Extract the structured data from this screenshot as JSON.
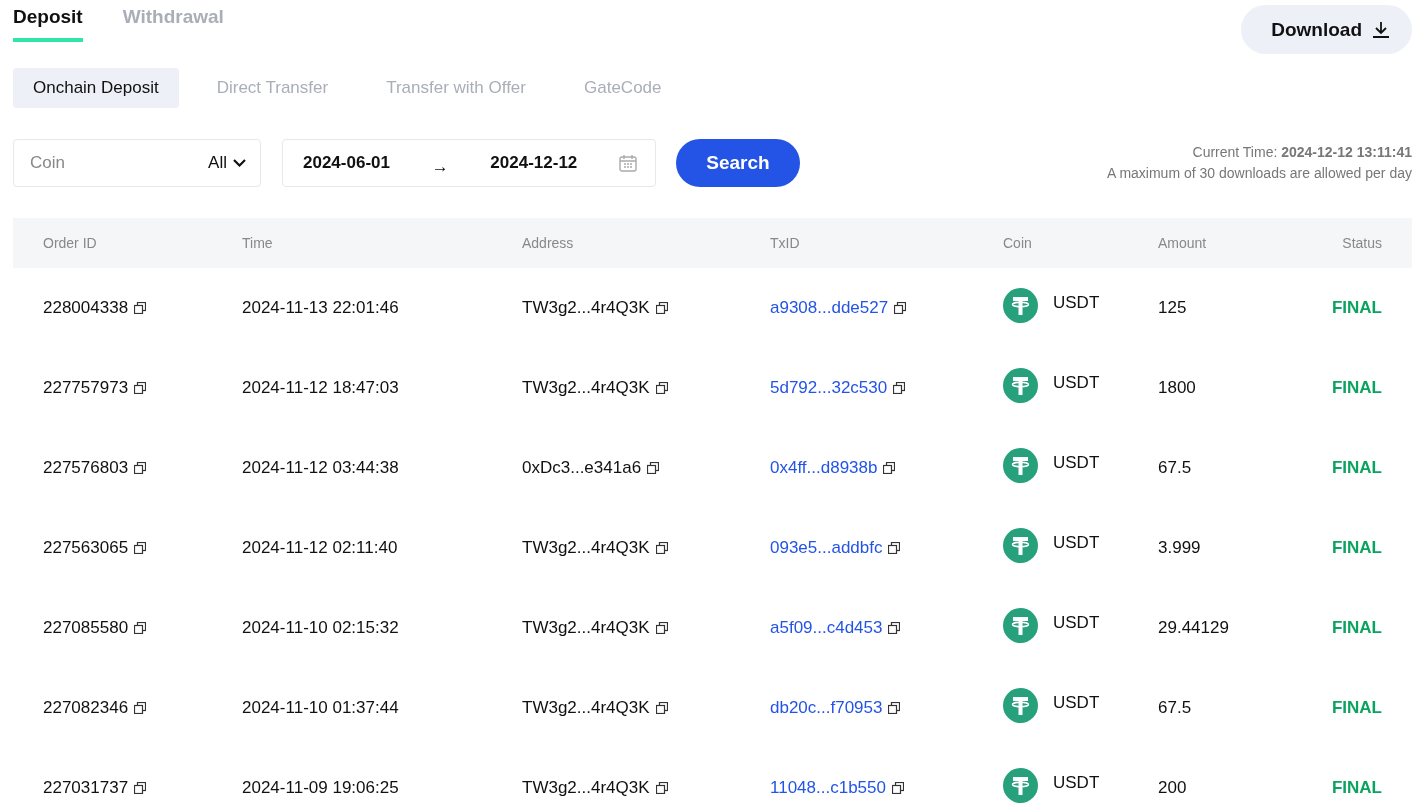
{
  "tabs": [
    {
      "label": "Deposit",
      "selected": true
    },
    {
      "label": "Withdrawal",
      "selected": false
    }
  ],
  "download_button": {
    "label": "Download"
  },
  "sub_tabs": [
    {
      "label": "Onchain Deposit",
      "selected": true
    },
    {
      "label": "Direct Transfer",
      "selected": false
    },
    {
      "label": "Transfer with Offer",
      "selected": false
    },
    {
      "label": "GateCode",
      "selected": false
    }
  ],
  "filters": {
    "coin": {
      "placeholder": "Coin",
      "value": "All"
    },
    "date_range": {
      "start": "2024-06-01",
      "separator": "→",
      "end": "2024-12-12"
    },
    "search_button": "Search"
  },
  "info": {
    "current_time": "Current Time: **2024-12-12 13:11:41**",
    "limit": "A maximum of 30 downloads are allowed per day"
  },
  "table": {
    "columns": [
      "Order ID",
      "Time",
      "Address",
      "TxID",
      "Coin",
      "Amount",
      "Status"
    ],
    "rows": [
      {
        "order_id": "228004338",
        "time": "2024-11-13 22:01:46",
        "address": "TW3g2...4r4Q3K",
        "txid": "a9308...dde527",
        "coin": "USDT",
        "amount": "125",
        "status": "FINAL"
      },
      {
        "order_id": "227757973",
        "time": "2024-11-12 18:47:03",
        "address": "TW3g2...4r4Q3K",
        "txid": "5d792...32c530",
        "coin": "USDT",
        "amount": "1800",
        "status": "FINAL"
      },
      {
        "order_id": "227576803",
        "time": "2024-11-12 03:44:38",
        "address": "0xDc3...e341a6",
        "txid": "0x4ff...d8938b",
        "coin": "USDT",
        "amount": "67.5",
        "status": "FINAL"
      },
      {
        "order_id": "227563065",
        "time": "2024-11-12 02:11:40",
        "address": "TW3g2...4r4Q3K",
        "txid": "093e5...addbfc",
        "coin": "USDT",
        "amount": "3.999",
        "status": "FINAL"
      },
      {
        "order_id": "227085580",
        "time": "2024-11-10 02:15:32",
        "address": "TW3g2...4r4Q3K",
        "txid": "a5f09...c4d453",
        "coin": "USDT",
        "amount": "29.44129",
        "status": "FINAL"
      },
      {
        "order_id": "227082346",
        "time": "2024-11-10 01:37:44",
        "address": "TW3g2...4r4Q3K",
        "txid": "db20c...f70953",
        "coin": "USDT",
        "amount": "67.5",
        "status": "FINAL"
      },
      {
        "order_id": "227031737",
        "time": "2024-11-09 19:06:25",
        "address": "TW3g2...4r4Q3K",
        "txid": "11048...c1b550",
        "coin": "USDT",
        "amount": "200",
        "status": "FINAL"
      }
    ]
  }
}
